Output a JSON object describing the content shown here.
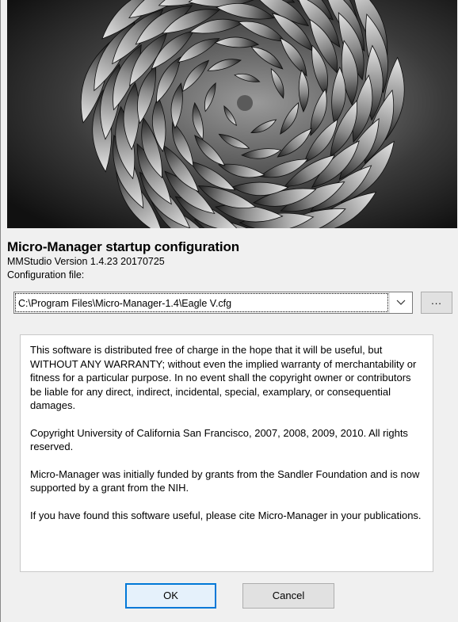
{
  "dialog": {
    "title": "Micro-Manager startup configuration",
    "version_text": "MMStudio Version 1.4.23 20170725",
    "config_label": "Configuration file:"
  },
  "config": {
    "selected_file": "C:\\Program Files\\Micro-Manager-1.4\\Eagle V.cfg",
    "browse_label": "..."
  },
  "license": {
    "paragraphs": [
      "This software is distributed free of charge in the hope that it will be useful, but WITHOUT ANY WARRANTY; without even the implied warranty of merchantability or fitness for a particular purpose. In no event shall the copyright owner or contributors be liable for any direct, indirect, incidental, special, examplary, or consequential damages.",
      "Copyright University of California San Francisco, 2007, 2008, 2009, 2010. All rights reserved.",
      "Micro-Manager was initially funded by grants from the Sandler Foundation and is now supported by a grant from the NIH.",
      "If you have found this software useful, please cite Micro-Manager in your publications."
    ]
  },
  "buttons": {
    "ok_label": "OK",
    "cancel_label": "Cancel"
  },
  "icons": {
    "dropdown": "chevron-down-icon",
    "splash": "spiral-aloe-photo"
  },
  "colors": {
    "accent": "#0078d7",
    "dialog_bg": "#f0f0f0"
  }
}
